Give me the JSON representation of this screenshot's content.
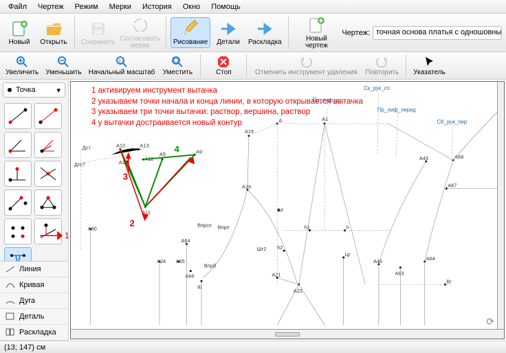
{
  "menubar": [
    "Файл",
    "Чертеж",
    "Режим",
    "Мерки",
    "История",
    "Окно",
    "Помощь"
  ],
  "toolbar1": {
    "new": "Новый",
    "open": "Открыть",
    "save": "Сохранить",
    "reconcile": "Согласовать\nмерки",
    "drawing": "Рисование",
    "details": "Детали",
    "layout": "Раскладка",
    "newdraft": "Новый чертеж",
    "doclabel": "Чертеж:",
    "docvalue": "точная основа платья с одношовным рука"
  },
  "toolbar2": {
    "zoomin": "Увеличить",
    "zoomout": "Уменьшить",
    "zoomreset": "Начальный масштаб",
    "fit": "Уместить",
    "stop": "Стоп",
    "undo": "Отменить инструмент удаления",
    "redo": "Повторить",
    "pointer": "Указатель"
  },
  "sidebar": {
    "combo": "Точка",
    "list": [
      "Линия",
      "Кривая",
      "Дуга",
      "Деталь",
      "Раскладка"
    ],
    "arrow_num": "1"
  },
  "instructions": [
    "1 активируем инструмент вытачка",
    "2 указываем точки начала и конца линии, в которую открывается вытачка",
    "3 указываем три точки вытачки: раствор, вершина, раствор",
    "4 у вытачки достраивается новый контур"
  ],
  "overlay_nums": {
    "n2": "2",
    "n3": "3",
    "n4": "4"
  },
  "points": {
    "Dst": "Дст",
    "Dts7": "Дтс7",
    "A80": "А80",
    "A24": "А24",
    "A65": "А65",
    "A10": "А10",
    "A13": "А13",
    "A12": "А12",
    "A14": "А14",
    "A5": "А5",
    "A11": "А11",
    "A9": "А9",
    "A15": "А15",
    "A": "А",
    "A16": "А16",
    "Vprsp": "Впрсп",
    "Vprn": "Впрп",
    "Vpr6": "Впрб",
    "A64": "А64",
    "A66": "А66",
    "Sh": "Ш",
    "Shr": "Шг",
    "Shr2": "Шг2",
    "A21": "А21",
    "A22": "А22",
    "A1": "А1",
    "h": "h",
    "h1": "h1",
    "h2": "h2",
    "Ts": "Цг",
    "Pr_lif_sp": "Пр_лиф_сп",
    "Pr_lif_pered": "Пр_лиф_перед",
    "SK_ruk_sp": "Ск_рук_сп",
    "SK_ruk_per": "СК_рук_пер",
    "A43": "А43",
    "A68": "А68",
    "A67": "А67",
    "A46": "А46",
    "A63": "А63",
    "A64b": "А64",
    "Bg": "Вг"
  },
  "status": "(13; 147) см"
}
